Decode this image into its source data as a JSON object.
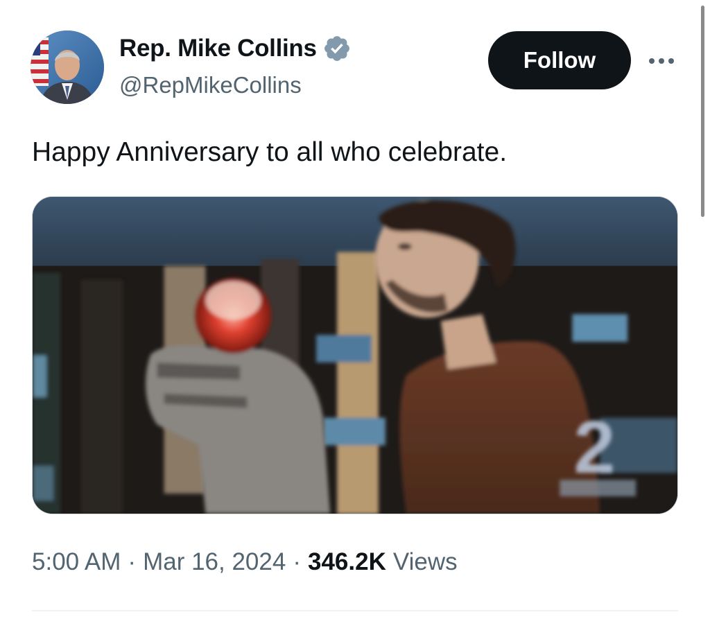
{
  "author": {
    "display_name": "Rep. Mike Collins",
    "handle": "@RepMikeCollins",
    "verified": true
  },
  "actions": {
    "follow_label": "Follow",
    "more_icon": "more-horizontal-icon"
  },
  "post": {
    "text": "Happy Anniversary to all who celebrate.",
    "media": {
      "kind": "video-still",
      "overlay_text": "2"
    }
  },
  "meta": {
    "time": "5:00 AM",
    "separator": "·",
    "date": "Mar 16, 2024",
    "views_count": "346.2K",
    "views_label": "Views"
  },
  "colors": {
    "text_primary": "#0f1419",
    "text_secondary": "#536471",
    "verified_badge": "#829aab",
    "follow_bg": "#0f1419",
    "divider": "#eff3f4"
  }
}
